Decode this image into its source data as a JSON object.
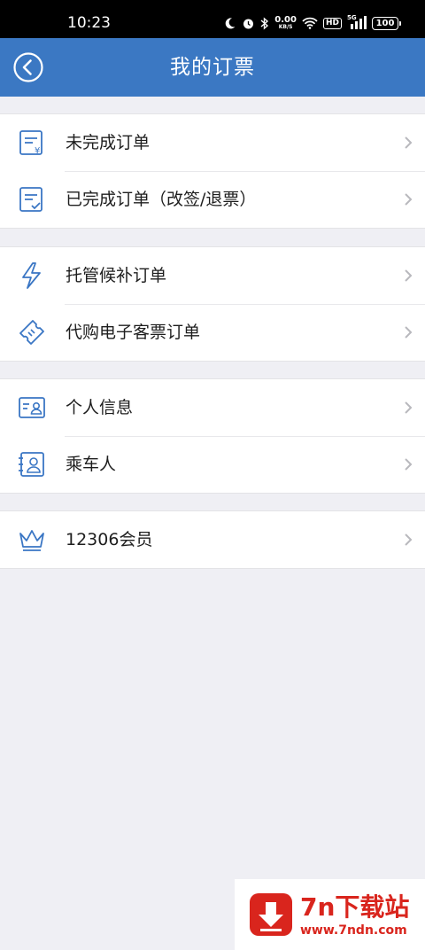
{
  "status_bar": {
    "time": "10:23",
    "net_speed_value": "0.00",
    "net_speed_unit": "KB/S",
    "hd_label": "HD",
    "network_label": "5G",
    "battery_level": "100",
    "icons": [
      "moon-icon",
      "alarm-icon",
      "bluetooth-icon",
      "wifi-icon",
      "signal-icon",
      "battery-icon"
    ]
  },
  "header": {
    "title": "我的订票",
    "back_icon": "back-circle-icon",
    "background_color": "#3b78c3"
  },
  "groups": [
    {
      "items": [
        {
          "label": "未完成订单",
          "icon": "unpaid-order-icon"
        },
        {
          "label": "已完成订单（改签/退票）",
          "icon": "completed-order-icon"
        }
      ]
    },
    {
      "items": [
        {
          "label": "托管候补订单",
          "icon": "lightning-icon"
        },
        {
          "label": "代购电子客票订单",
          "icon": "ticket-icon"
        }
      ]
    },
    {
      "items": [
        {
          "label": "个人信息",
          "icon": "id-card-icon"
        },
        {
          "label": "乘车人",
          "icon": "passenger-icon"
        }
      ]
    },
    {
      "items": [
        {
          "label": "12306会员",
          "icon": "crown-icon"
        }
      ]
    }
  ],
  "colors": {
    "accent": "#3b78c3",
    "icon": "#3a76c4",
    "page_background": "#efeff4"
  },
  "watermark": {
    "title": "7n下载站",
    "url": "www.7ndn.com",
    "color": "#d9251d"
  }
}
